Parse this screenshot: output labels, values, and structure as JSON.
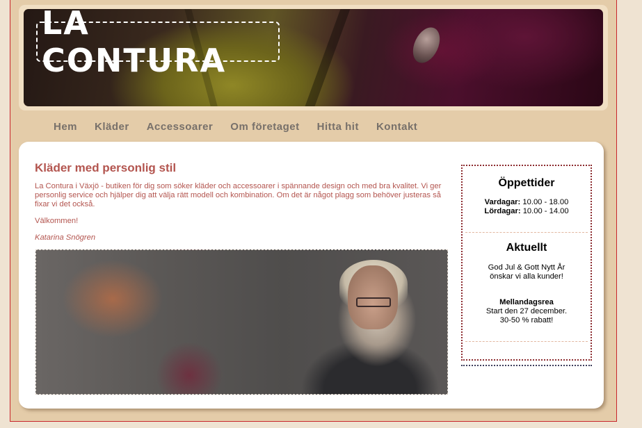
{
  "logo": {
    "text": "LA CONTURA"
  },
  "nav": {
    "items": [
      "Hem",
      "Kläder",
      "Accessoarer",
      "Om företaget",
      "Hitta hit",
      "Kontakt"
    ]
  },
  "main": {
    "heading": "Kläder med personlig stil",
    "intro": "La Contura i Växjö - butiken för dig som söker kläder och accessoarer i spännande design och med bra kvalitet. Vi ger personlig service och hjälper dig att välja rätt modell och kombination. Om det är något plagg som behöver justeras så fixar vi det också.",
    "welcome": "Välkommen!",
    "signature": "Katarina Snögren"
  },
  "sidebar": {
    "hours": {
      "heading": "Öppettider",
      "weekday_label": "Vardagar:",
      "weekday_time": "10.00 - 18.00",
      "saturday_label": "Lördagar:",
      "saturday_time": "10.00 - 14.00"
    },
    "news": {
      "heading": "Aktuellt",
      "line1": "God Jul & Gott Nytt År",
      "line2": "önskar vi alla kunder!",
      "sale_title": "Mellandagsrea",
      "sale_line1": "Start den 27 december.",
      "sale_line2": "30-50 % rabatt!"
    }
  },
  "colors": {
    "page_bg": "#efe3d2",
    "frame": "#e4cca9",
    "accent": "#b3554f",
    "nav_text": "#77706a",
    "border_red": "#c9252b"
  }
}
